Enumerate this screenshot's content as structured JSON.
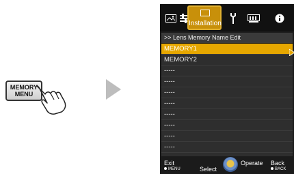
{
  "remote": {
    "line1": "MEMORY",
    "line2": "MENU"
  },
  "menu": {
    "tabs": [
      {
        "icon": "picture-icon"
      },
      {
        "icon": "adjust-icon"
      },
      {
        "icon": "installation-icon",
        "label": "Installation",
        "active": true
      },
      {
        "icon": "tool-icon"
      },
      {
        "icon": "display-setup-icon"
      },
      {
        "icon": "info-icon"
      }
    ],
    "breadcrumb": ">> Lens Memory Name Edit",
    "items": [
      "MEMORY1",
      "MEMORY2",
      "-----",
      "-----",
      "-----",
      "-----",
      "-----",
      "-----",
      "-----",
      "-----"
    ],
    "selected_index": 0,
    "footer": {
      "exit": "Exit",
      "exit_key": "MENU",
      "select": "Select",
      "operate": "Operate",
      "back": "Back",
      "back_key": "BACK"
    }
  },
  "colors": {
    "accent": "#e6a700",
    "tab_active": "#c8900a",
    "background": "#1b1b1b"
  }
}
